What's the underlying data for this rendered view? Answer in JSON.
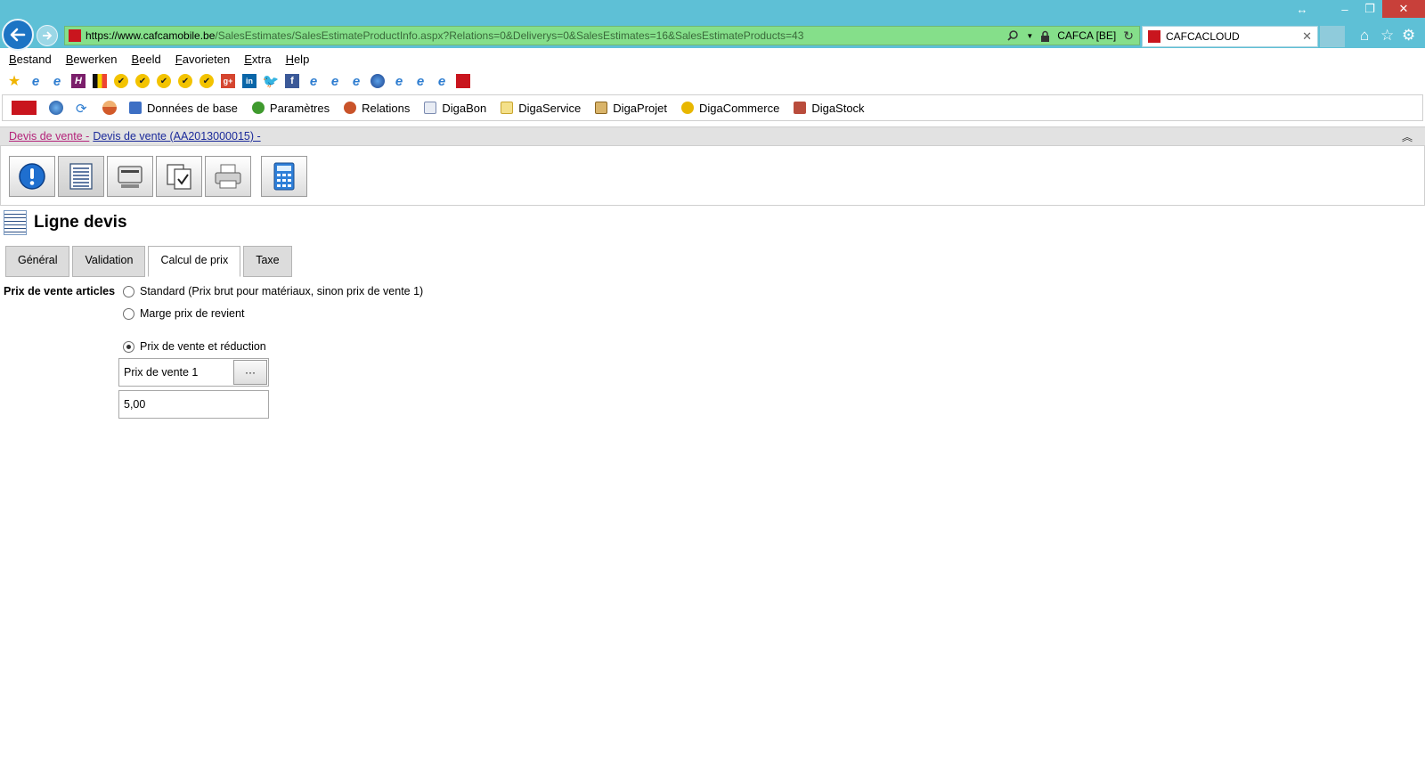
{
  "browser": {
    "url_host": "https://www.cafcamobile.be",
    "url_path": "/SalesEstimates/SalesEstimateProductInfo.aspx?Relations=0&Deliverys=0&SalesEstimates=16&SalesEstimateProducts=43",
    "site_identity": "CAFCA [BE]",
    "tab_title": "CAFCACLOUD",
    "theme_color": "#5ec0d6",
    "address_color": "#85df8a"
  },
  "menu": [
    "Bestand",
    "Bewerken",
    "Beeld",
    "Favorieten",
    "Extra",
    "Help"
  ],
  "app_menu": [
    {
      "label": "Données de base",
      "icon": "database-icon",
      "color": "#3d6fc4"
    },
    {
      "label": "Paramètres",
      "icon": "settings-gear-icon",
      "color": "#3f9a2e"
    },
    {
      "label": "Relations",
      "icon": "people-icon",
      "color": "#c9532a"
    },
    {
      "label": "DigaBon",
      "icon": "document-icon",
      "color": "#7a8ab0"
    },
    {
      "label": "DigaService",
      "icon": "folder-icon",
      "color": "#e2c246"
    },
    {
      "label": "DigaProjet",
      "icon": "project-icon",
      "color": "#b88b30"
    },
    {
      "label": "DigaCommerce",
      "icon": "coin-icon",
      "color": "#e8b700"
    },
    {
      "label": "DigaStock",
      "icon": "stock-box-icon",
      "color": "#b94c3c"
    }
  ],
  "breadcrumb": {
    "first": "Devis de vente -",
    "second": "Devis de vente (AA2013000015) -"
  },
  "page": {
    "title": "Ligne devis"
  },
  "tabs": [
    {
      "label": "Général",
      "selected": false
    },
    {
      "label": "Validation",
      "selected": false
    },
    {
      "label": "Calcul de prix",
      "selected": true
    },
    {
      "label": "Taxe",
      "selected": false
    }
  ],
  "form": {
    "label": "Prix de vente articles",
    "options": [
      {
        "label": "Standard (Prix brut pour matériaux, sinon prix de vente 1)",
        "checked": false
      },
      {
        "label": "Marge prix de revient",
        "checked": false
      },
      {
        "label": "Prix de vente et réduction",
        "checked": true
      }
    ],
    "price_select_value": "Prix de vente 1",
    "picker_label": "···",
    "discount_value": "5,00"
  }
}
